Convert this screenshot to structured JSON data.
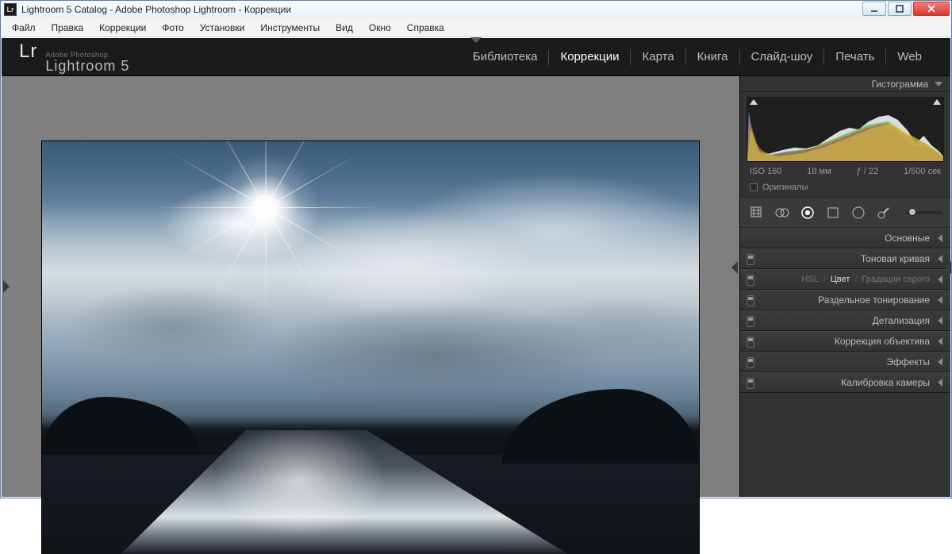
{
  "window": {
    "title": "Lightroom 5 Catalog - Adobe Photoshop Lightroom - Коррекции",
    "app_icon_text": "Lr"
  },
  "menubar": [
    "Файл",
    "Правка",
    "Коррекции",
    "Фото",
    "Установки",
    "Инструменты",
    "Вид",
    "Окно",
    "Справка"
  ],
  "identity": {
    "lr": "Lr",
    "brand_small": "Adobe Photoshop",
    "brand_large": "Lightroom 5"
  },
  "modules": [
    {
      "label": "Библиотека",
      "active": false
    },
    {
      "label": "Коррекции",
      "active": true
    },
    {
      "label": "Карта",
      "active": false
    },
    {
      "label": "Книга",
      "active": false
    },
    {
      "label": "Слайд-шоу",
      "active": false
    },
    {
      "label": "Печать",
      "active": false
    },
    {
      "label": "Web",
      "active": false
    }
  ],
  "right_panel": {
    "histogram_title": "Гистограмма",
    "exif": {
      "iso": "ISO 160",
      "focal": "18 мм",
      "aperture": "ƒ / 22",
      "shutter": "1/500 сек"
    },
    "originals_label": "Оригиналы",
    "sections": [
      {
        "label": "Основные",
        "switch": false,
        "sub": null
      },
      {
        "label": "Тоновая кривая",
        "switch": true,
        "sub": null
      },
      {
        "label": "",
        "switch": true,
        "sub": {
          "items": [
            "HSL",
            "Цвет",
            "Градации серого"
          ],
          "active": 1
        }
      },
      {
        "label": "Раздельное тонирование",
        "switch": true,
        "sub": null
      },
      {
        "label": "Детализация",
        "switch": true,
        "sub": null
      },
      {
        "label": "Коррекция объектива",
        "switch": true,
        "sub": null
      },
      {
        "label": "Эффекты",
        "switch": true,
        "sub": null
      },
      {
        "label": "Калибровка камеры",
        "switch": true,
        "sub": null
      }
    ]
  }
}
